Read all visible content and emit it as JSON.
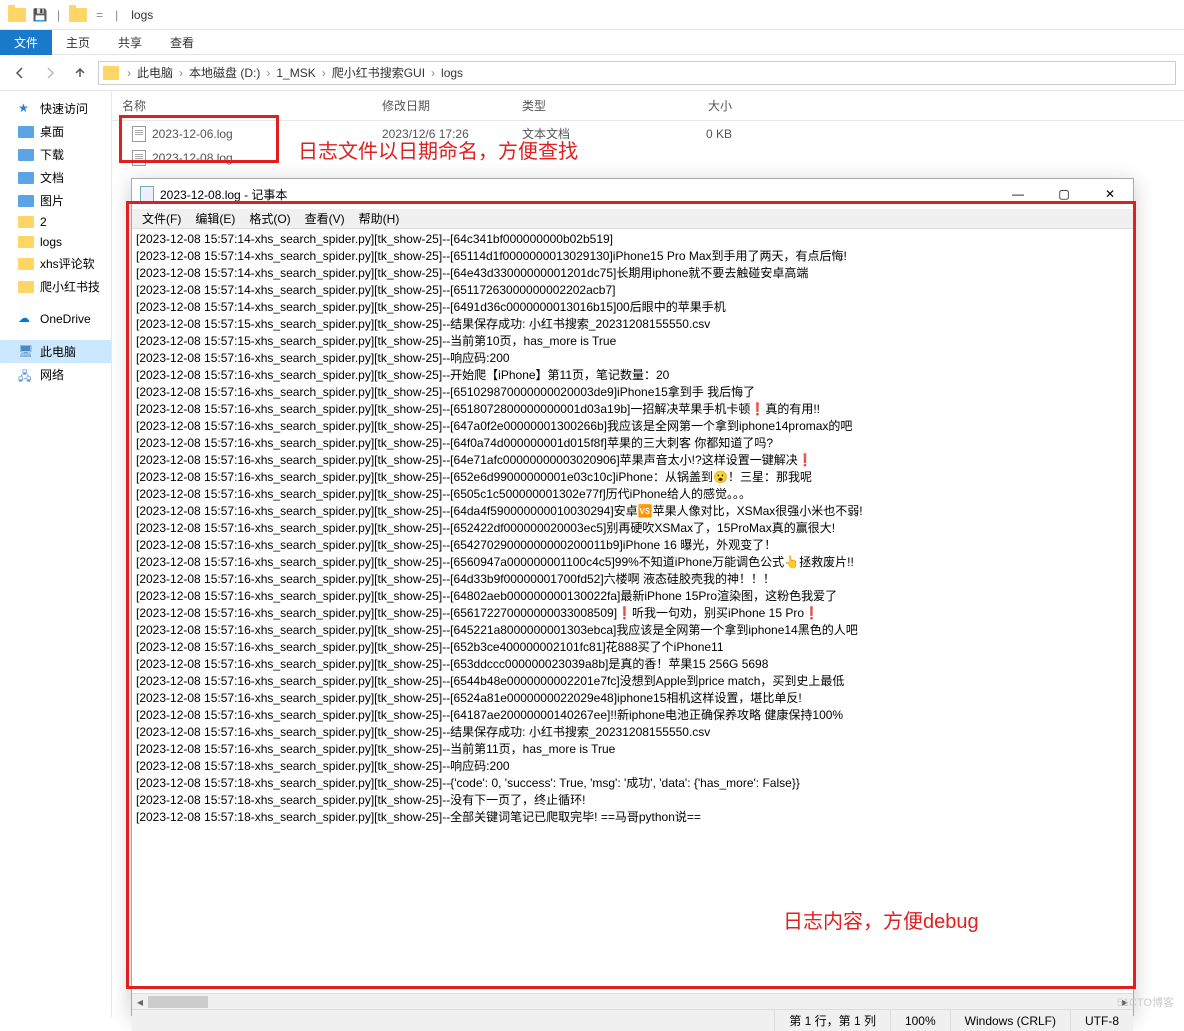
{
  "explorer": {
    "title": "logs",
    "ribbon": {
      "file": "文件",
      "home": "主页",
      "share": "共享",
      "view": "查看"
    },
    "breadcrumb": [
      "此电脑",
      "本地磁盘 (D:)",
      "1_MSK",
      "爬小红书搜索GUI",
      "logs"
    ],
    "columns": {
      "name": "名称",
      "date": "修改日期",
      "type": "类型",
      "size": "大小"
    },
    "files": [
      {
        "name": "2023-12-06.log",
        "date": "2023/12/6 17:26",
        "type": "文本文档",
        "size": "0 KB"
      },
      {
        "name": "2023-12-08.log",
        "date": "",
        "type": "",
        "size": ""
      }
    ],
    "sidebar": [
      {
        "label": "快速访问",
        "icon": "star"
      },
      {
        "label": "桌面",
        "icon": "folder-blue"
      },
      {
        "label": "下载",
        "icon": "folder-blue"
      },
      {
        "label": "文档",
        "icon": "folder-blue"
      },
      {
        "label": "图片",
        "icon": "folder-blue"
      },
      {
        "label": "2",
        "icon": "folder"
      },
      {
        "label": "logs",
        "icon": "folder"
      },
      {
        "label": "xhs评论软",
        "icon": "folder"
      },
      {
        "label": "爬小红书技",
        "icon": "folder"
      },
      {
        "label": "OneDrive",
        "icon": "cloud"
      },
      {
        "label": "此电脑",
        "icon": "pc",
        "sel": true
      },
      {
        "label": "网络",
        "icon": "net"
      }
    ]
  },
  "annotations": {
    "top": "日志文件以日期命名，方便查找",
    "bottom": "日志内容，方便debug"
  },
  "notepad": {
    "title": "2023-12-08.log - 记事本",
    "menus": [
      "文件(F)",
      "编辑(E)",
      "格式(O)",
      "查看(V)",
      "帮助(H)"
    ],
    "status": {
      "pos": "第 1 行，第 1 列",
      "zoom": "100%",
      "eol": "Windows (CRLF)",
      "enc": "UTF-8"
    },
    "lines": [
      "[2023-12-08 15:57:14-xhs_search_spider.py][tk_show-25]--[64c341bf000000000b02b519]",
      "[2023-12-08 15:57:14-xhs_search_spider.py][tk_show-25]--[65114d1f0000000013029130]iPhone15 Pro Max到手用了两天，有点后悔!",
      "[2023-12-08 15:57:14-xhs_search_spider.py][tk_show-25]--[64e43d33000000001201dc75]长期用iphone就不要去触碰安卓高端",
      "[2023-12-08 15:57:14-xhs_search_spider.py][tk_show-25]--[65117263000000002202acb7]",
      "[2023-12-08 15:57:14-xhs_search_spider.py][tk_show-25]--[6491d36c0000000013016b15]00后眼中的苹果手机",
      "[2023-12-08 15:57:15-xhs_search_spider.py][tk_show-25]--结果保存成功: 小红书搜索_20231208155550.csv",
      "[2023-12-08 15:57:15-xhs_search_spider.py][tk_show-25]--当前第10页，has_more is True",
      "[2023-12-08 15:57:16-xhs_search_spider.py][tk_show-25]--响应码:200",
      "[2023-12-08 15:57:16-xhs_search_spider.py][tk_show-25]--开始爬【iPhone】第11页，笔记数量：20",
      "[2023-12-08 15:57:16-xhs_search_spider.py][tk_show-25]--[651029870000000020003de9]iPhone15拿到手 我后悔了",
      "[2023-12-08 15:57:16-xhs_search_spider.py][tk_show-25]--[6518072800000000001d03a19b]一招解决苹果手机卡顿❗真的有用!!",
      "[2023-12-08 15:57:16-xhs_search_spider.py][tk_show-25]--[647a0f2e00000001300266b]我应该是全网第一个拿到iphone14promax的吧",
      "[2023-12-08 15:57:16-xhs_search_spider.py][tk_show-25]--[64f0a74d000000001d015f8f]苹果的三大刺客 你都知道了吗?",
      "[2023-12-08 15:57:16-xhs_search_spider.py][tk_show-25]--[64e71afc00000000003020906]苹果声音太小!?这样设置一键解决❗",
      "[2023-12-08 15:57:16-xhs_search_spider.py][tk_show-25]--[652e6d99000000001e03c10c]iPhone：从锅盖到😮！三星：那我呢",
      "[2023-12-08 15:57:16-xhs_search_spider.py][tk_show-25]--[6505c1c500000001302e77f]历代iPhone给人的感觉。。。",
      "[2023-12-08 15:57:16-xhs_search_spider.py][tk_show-25]--[64da4f590000000010030294]安卓🆚苹果人像对比，XSMax很强小米也不弱!",
      "[2023-12-08 15:57:16-xhs_search_spider.py][tk_show-25]--[652422df000000020003ec5]别再硬吹XSMax了，15ProMax真的赢很大!",
      "[2023-12-08 15:57:16-xhs_search_spider.py][tk_show-25]--[65427029000000000200011b9]iPhone 16 曝光，外观变了！",
      "[2023-12-08 15:57:16-xhs_search_spider.py][tk_show-25]--[6560947a000000001100c4c5]99%不知道iPhone万能调色公式👆拯救废片!!",
      "[2023-12-08 15:57:16-xhs_search_spider.py][tk_show-25]--[64d33b9f00000001700fd52]六楼啊 液态硅胶壳我的神！！！",
      "[2023-12-08 15:57:16-xhs_search_spider.py][tk_show-25]--[64802aeb000000000130022fa]最新iPhone 15Pro渲染图，这粉色我爱了",
      "[2023-12-08 15:57:16-xhs_search_spider.py][tk_show-25]--[656172270000000033008509]❗听我一句劝，别买iPhone 15 Pro❗",
      "[2023-12-08 15:57:16-xhs_search_spider.py][tk_show-25]--[645221a8000000001303ebca]我应该是全网第一个拿到iphone14黑色的人吧",
      "[2023-12-08 15:57:16-xhs_search_spider.py][tk_show-25]--[652b3ce400000002101fc81]花888买了个iPhone11",
      "[2023-12-08 15:57:16-xhs_search_spider.py][tk_show-25]--[653ddccc000000023039a8b]是真的香！苹果15 256G 5698",
      "[2023-12-08 15:57:16-xhs_search_spider.py][tk_show-25]--[6544b48e0000000002201e7fc]没想到Apple到price match，买到史上最低",
      "[2023-12-08 15:57:16-xhs_search_spider.py][tk_show-25]--[6524a81e0000000022029e48]iphone15相机这样设置，堪比单反!",
      "[2023-12-08 15:57:16-xhs_search_spider.py][tk_show-25]--[64187ae20000000140267ee]!!新iphone电池正确保养攻略 健康保持100%",
      "[2023-12-08 15:57:16-xhs_search_spider.py][tk_show-25]--结果保存成功: 小红书搜索_20231208155550.csv",
      "[2023-12-08 15:57:16-xhs_search_spider.py][tk_show-25]--当前第11页，has_more is True",
      "[2023-12-08 15:57:18-xhs_search_spider.py][tk_show-25]--响应码:200",
      "[2023-12-08 15:57:18-xhs_search_spider.py][tk_show-25]--{'code': 0, 'success': True, 'msg': '成功', 'data': {'has_more': False}}",
      "[2023-12-08 15:57:18-xhs_search_spider.py][tk_show-25]--没有下一页了，终止循环!",
      "[2023-12-08 15:57:18-xhs_search_spider.py][tk_show-25]--全部关键词笔记已爬取完毕! ==马哥python说=="
    ]
  },
  "watermark": "51CTO博客"
}
